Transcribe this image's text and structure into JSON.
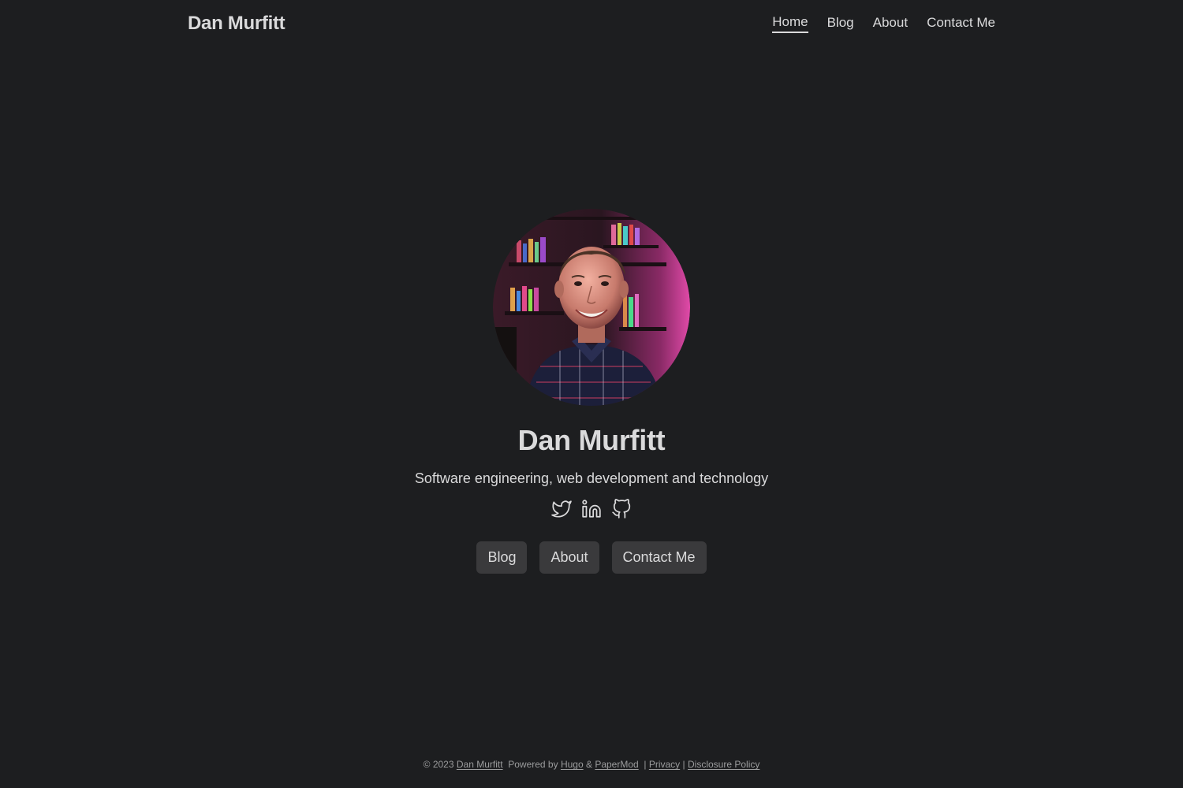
{
  "header": {
    "logo": "Dan Murfitt",
    "nav": [
      {
        "label": "Home",
        "active": true
      },
      {
        "label": "Blog",
        "active": false
      },
      {
        "label": "About",
        "active": false
      },
      {
        "label": "Contact Me",
        "active": false
      }
    ]
  },
  "profile": {
    "name": "Dan Murfitt",
    "subtitle": "Software engineering, web development and technology",
    "social_icons": [
      "twitter-icon",
      "linkedin-icon",
      "github-icon"
    ],
    "buttons": [
      "Blog",
      "About",
      "Contact Me"
    ]
  },
  "footer": {
    "copyright": "© 2023",
    "author_link": "Dan Murfitt",
    "powered_by": "Powered by",
    "hugo_link": "Hugo",
    "amp": "&",
    "papermod_link": "PaperMod",
    "sep1": "|",
    "privacy_link": "Privacy",
    "sep2": "|",
    "disclosure_link": "Disclosure Policy"
  },
  "colors": {
    "background": "#1d1e20",
    "text": "#dadadb",
    "button_bg": "#3a3a3c",
    "footer_text": "#9b9c9d"
  }
}
